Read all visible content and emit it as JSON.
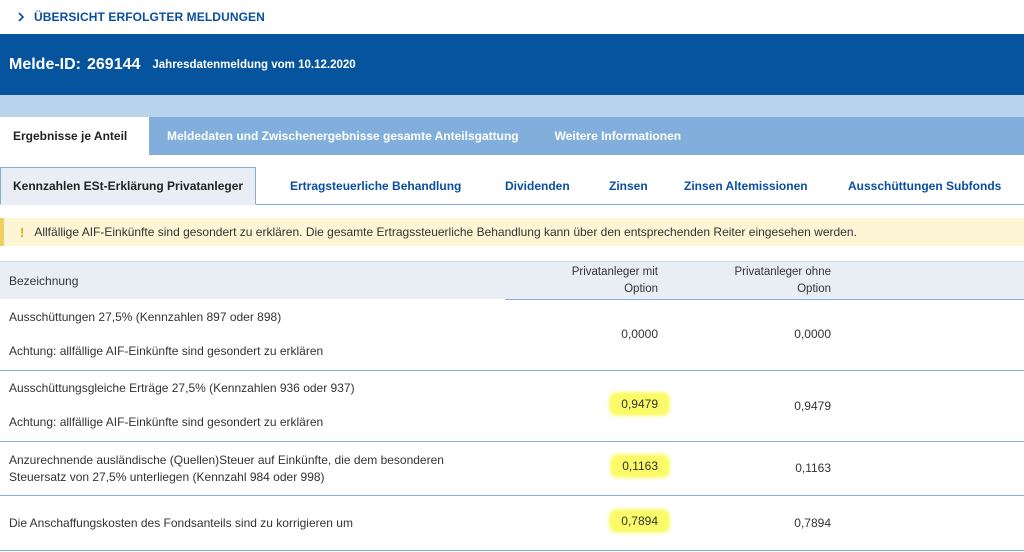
{
  "breadcrumb": {
    "label": "ÜBERSICHT ERFOLGTER MELDUNGEN"
  },
  "header": {
    "id_label": "Melde-ID:",
    "id_value": "269144",
    "subtitle": "Jahresdatenmeldung vom 10.12.2020"
  },
  "tabs_primary": [
    {
      "label": "Ergebnisse je Anteil",
      "active": true
    },
    {
      "label": "Meldedaten und Zwischenergebnisse gesamte Anteilsgattung",
      "active": false
    },
    {
      "label": "Weitere Informationen",
      "active": false
    }
  ],
  "tabs_secondary": [
    {
      "label": "Kennzahlen ESt-Erklärung Privatanleger",
      "active": true
    },
    {
      "label": "Ertragsteuerliche Behandlung",
      "active": false
    },
    {
      "label": "Dividenden",
      "active": false
    },
    {
      "label": "Zinsen",
      "active": false
    },
    {
      "label": "Zinsen Altemissionen",
      "active": false
    },
    {
      "label": "Ausschüttungen Subfonds",
      "active": false
    }
  ],
  "alert": {
    "icon": "!",
    "text": "Allfällige AIF-Einkünfte sind gesondert zu erklären. Die gesamte Ertragssteuerliche Behandlung kann über den entsprechenden Reiter eingesehen werden."
  },
  "table": {
    "headers": {
      "bezeichnung": "Bezeichnung",
      "col1_line1": "Privatanleger mit",
      "col1_line2": "Option",
      "col2_line1": "Privatanleger ohne",
      "col2_line2": "Option"
    },
    "rows": [
      {
        "line1": "Ausschüttungen 27,5% (Kennzahlen 897 oder 898)",
        "line2": "Achtung: allfällige AIF-Einkünfte sind gesondert zu erklären",
        "with_option": "0,0000",
        "without_option": "0,0000",
        "highlighted": false
      },
      {
        "line1": "Ausschüttungsgleiche Erträge 27,5% (Kennzahlen 936 oder 937)",
        "line2": "Achtung: allfällige AIF-Einkünfte sind gesondert zu erklären",
        "with_option": "0,9479",
        "without_option": "0,9479",
        "highlighted": true
      },
      {
        "line1": "Anzurechnende ausländische (Quellen)Steuer auf Einkünfte, die dem besonderen",
        "line2": "Steuersatz von 27,5% unterliegen (Kennzahl 984 oder 998)",
        "with_option": "0,1163",
        "without_option": "0,1163",
        "highlighted": true
      },
      {
        "line1": "Die Anschaffungskosten des Fondsanteils sind zu korrigieren um",
        "line2": "",
        "with_option": "0,7894",
        "without_option": "0,7894",
        "highlighted": true
      }
    ]
  },
  "colors": {
    "header_bg": "#07549e",
    "tab_bar_bg": "#82aedb",
    "highlight": "#fbfb6a",
    "link": "#0a4ea0"
  }
}
